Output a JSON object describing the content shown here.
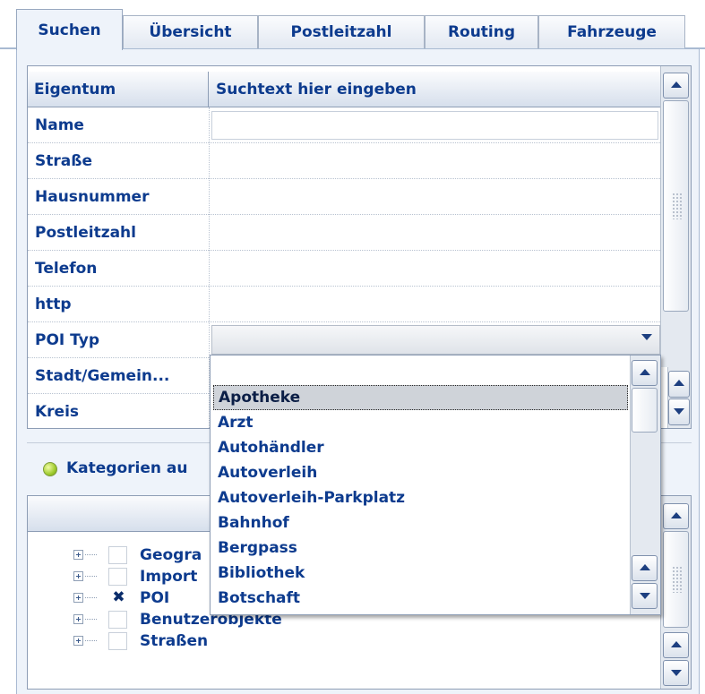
{
  "tabs": [
    {
      "label": "Suchen",
      "active": true
    },
    {
      "label": "Übersicht"
    },
    {
      "label": "Postleitzahl"
    },
    {
      "label": "Routing"
    },
    {
      "label": "Fahrzeuge"
    }
  ],
  "property_grid": {
    "header_property": "Eigentum",
    "header_search": "Suchtext hier eingeben",
    "rows": [
      "Name",
      "Straße",
      "Hausnummer",
      "Postleitzahl",
      "Telefon",
      "http",
      "POI Typ",
      "Stadt/Gemein...",
      "Kreis"
    ],
    "name_value": "",
    "poi_typ_value": ""
  },
  "poi_dropdown": {
    "options": [
      "Apotheke",
      "Arzt",
      "Autohändler",
      "Autoverleih",
      "Autoverleih-Parkplatz",
      "Bahnhof",
      "Bergpass",
      "Bibliothek",
      "Botschaft"
    ],
    "selected": "Apotheke"
  },
  "categories": {
    "title": "Kategorien au",
    "items": [
      {
        "label": "Geogra",
        "checked": false
      },
      {
        "label": "Import",
        "checked": false
      },
      {
        "label": "POI",
        "checked": true
      },
      {
        "label": "Benutzerobjekte",
        "checked": false
      },
      {
        "label": "Straßen",
        "checked": false
      }
    ]
  },
  "icons": {
    "scroll_up": "arrow-up-icon",
    "scroll_down": "arrow-down-icon",
    "dropdown_caret": "chevron-down-icon",
    "expander": "plus-box-icon",
    "checked_mark": "x-mark-icon",
    "section_bullet": "green-dot-icon"
  },
  "colors": {
    "text": "#0d3b8e",
    "panel_background": "#eef3fa",
    "border": "#8d9db5",
    "selection": "#cfd3d9"
  }
}
